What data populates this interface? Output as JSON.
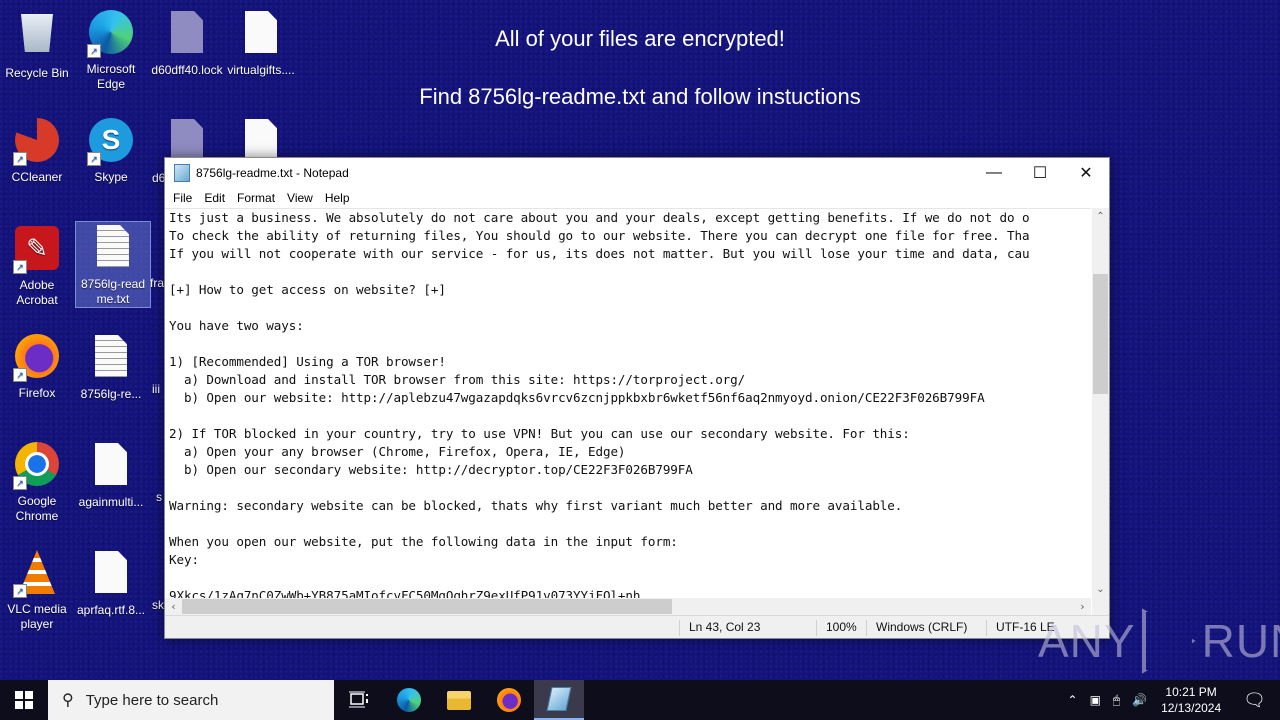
{
  "desktop": {
    "banner_line1": "All of your files are encrypted!",
    "banner_line2": "Find 8756lg-readme.txt and follow instuctions",
    "icons": [
      {
        "label": "Recycle Bin",
        "icon": "recycle-bin-icon"
      },
      {
        "label": "Microsoft Edge",
        "icon": "edge-icon"
      },
      {
        "label": "d60dff40.lock",
        "icon": "locked-file-icon"
      },
      {
        "label": "virtualgifts....",
        "icon": "file-icon"
      },
      {
        "label": "CCleaner",
        "icon": "ccleaner-icon"
      },
      {
        "label": "Skype",
        "icon": "skype-icon"
      },
      {
        "label": "d6",
        "icon": "locked-file-icon"
      },
      {
        "label": "",
        "icon": "file-icon"
      },
      {
        "label": "Adobe Acrobat",
        "icon": "acrobat-icon"
      },
      {
        "label": "8756lg-readme.txt",
        "icon": "text-file-icon",
        "selected": true
      },
      {
        "label": "fra",
        "icon": "file-icon"
      },
      {
        "label": "Firefox",
        "icon": "firefox-icon"
      },
      {
        "label": "8756lg-re...",
        "icon": "text-file-icon"
      },
      {
        "label": "iii",
        "icon": "file-icon"
      },
      {
        "label": "Google Chrome",
        "icon": "chrome-icon"
      },
      {
        "label": "againmulti...",
        "icon": "file-icon"
      },
      {
        "label": "s",
        "icon": "file-icon"
      },
      {
        "label": "VLC media player",
        "icon": "vlc-icon"
      },
      {
        "label": "aprfaq.rtf.8...",
        "icon": "file-icon"
      },
      {
        "label": "sk",
        "icon": "file-icon"
      }
    ],
    "watermark": "ANY RUN"
  },
  "notepad": {
    "title": "8756lg-readme.txt - Notepad",
    "menu": [
      "File",
      "Edit",
      "Format",
      "View",
      "Help"
    ],
    "lines": [
      "Its just a business. We absolutely do not care about you and your deals, except getting benefits. If we do not do o",
      "To check the ability of returning files, You should go to our website. There you can decrypt one file for free. Tha",
      "If you will not cooperate with our service - for us, its does not matter. But you will lose your time and data, cau",
      "",
      "[+] How to get access on website? [+]",
      "",
      "You have two ways:",
      "",
      "1) [Recommended] Using a TOR browser!",
      "  a) Download and install TOR browser from this site: https://torproject.org/",
      "  b) Open our website: http://aplebzu47wgazapdqks6vrcv6zcnjppkbxbr6wketf56nf6aq2nmyoyd.onion/CE22F3F026B799FA",
      "",
      "2) If TOR blocked in your country, try to use VPN! But you can use our secondary website. For this:",
      "  a) Open your any browser (Chrome, Firefox, Opera, IE, Edge)",
      "  b) Open our secondary website: http://decryptor.top/CE22F3F026B799FA",
      "",
      "Warning: secondary website can be blocked, thats why first variant much better and more available.",
      "",
      "When you open our website, put the following data in the input form:",
      "Key:",
      "",
      "9Xkcs/1zAq7nC0ZwWb+YB875aMIofcvFC50MgQqhrZ9exUfP91v073YYjFQl+nh"
    ],
    "status": {
      "position": "Ln 43, Col 23",
      "zoom": "100%",
      "line_endings": "Windows (CRLF)",
      "encoding": "UTF-16 LE"
    }
  },
  "taskbar": {
    "search_placeholder": "Type here to search",
    "time": "10:21 PM",
    "date": "12/13/2024"
  }
}
